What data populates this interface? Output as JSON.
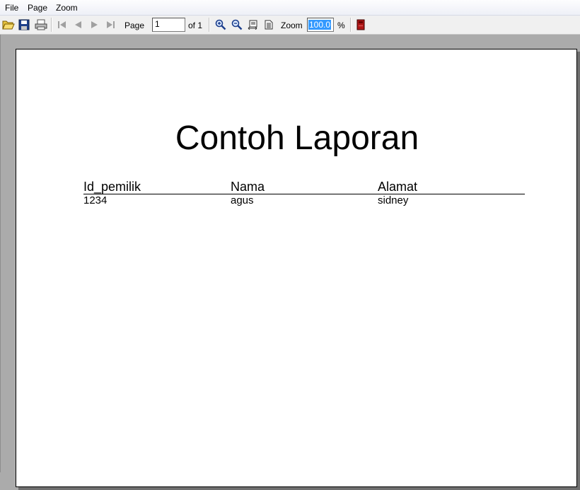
{
  "menu": {
    "items": [
      "File",
      "Page",
      "Zoom"
    ]
  },
  "toolbar": {
    "page_label": "Page",
    "page_value": "1",
    "page_of": "of 1",
    "zoom_label": "Zoom",
    "zoom_value": "100.0",
    "zoom_unit": "%"
  },
  "icons": {
    "open": "folder-open-icon",
    "save": "save-icon",
    "print": "printer-icon",
    "first": "first-page-icon",
    "prev": "previous-page-icon",
    "next": "next-page-icon",
    "last": "last-page-icon",
    "zoom_in": "zoom-in-icon",
    "zoom_out": "zoom-out-icon",
    "page_width": "page-width-icon",
    "whole_page": "whole-page-icon",
    "close": "close-icon"
  },
  "report": {
    "title": "Contoh Laporan",
    "columns": [
      "Id_pemilik",
      "Nama",
      "Alamat"
    ],
    "rows": [
      [
        "1234",
        "agus",
        "sidney"
      ]
    ]
  },
  "colors": {
    "menu_bg": "#f5f6fa",
    "toolbar_bg": "#f0f0f0",
    "viewer_bg": "#ababab",
    "selection": "#3399ff",
    "close_icon": "#b01818"
  }
}
